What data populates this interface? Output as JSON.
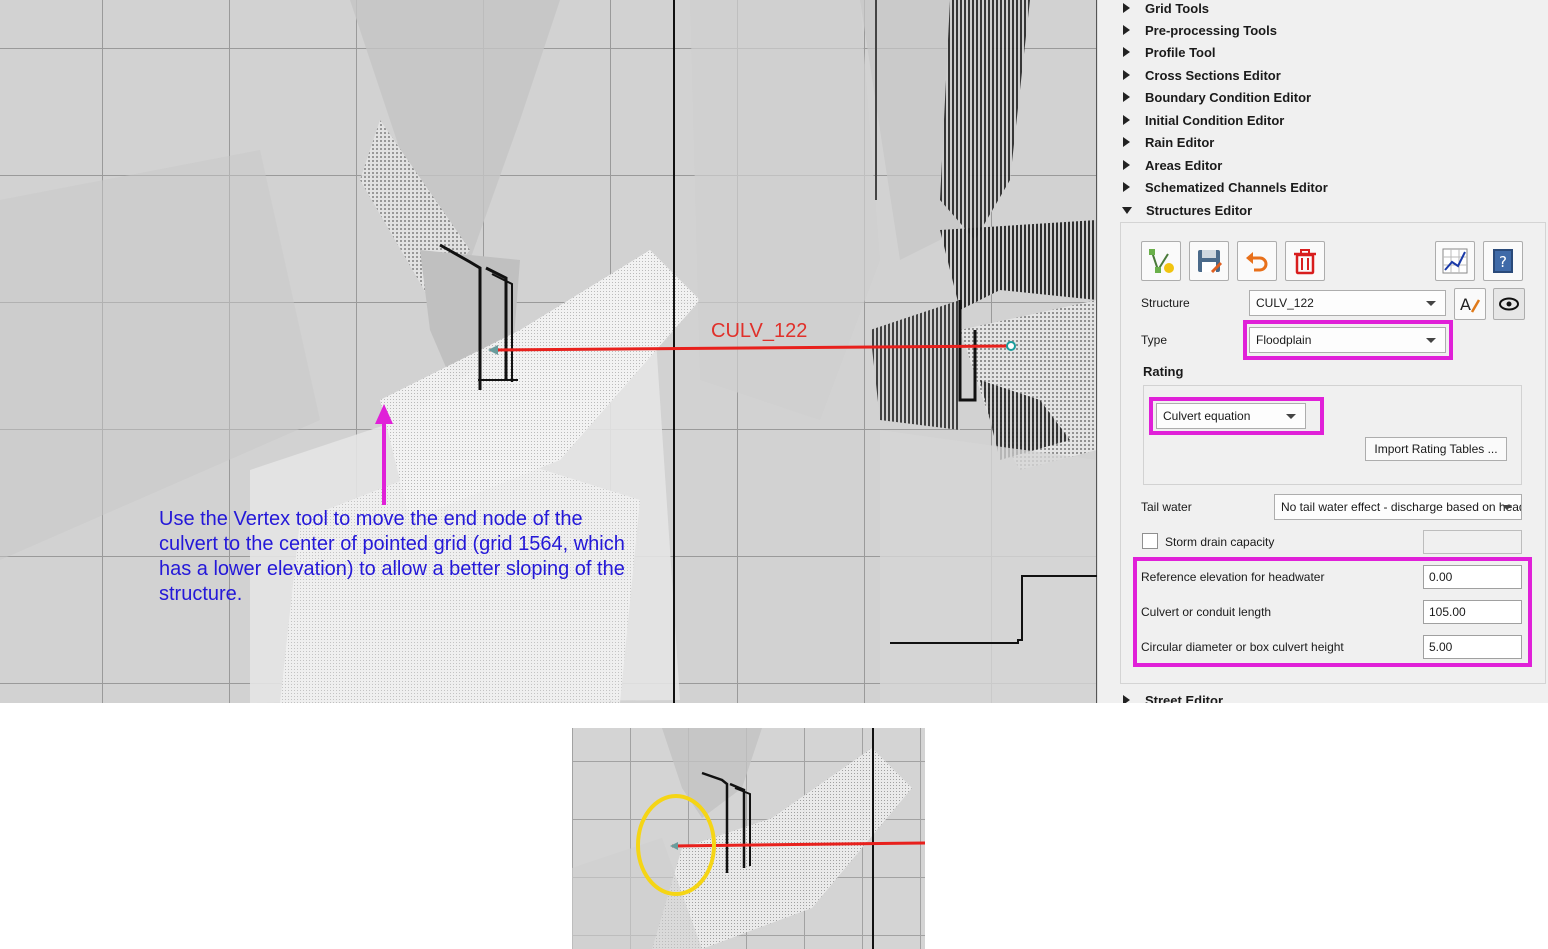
{
  "map": {
    "culvert_label": "CULV_122",
    "instruction": "Use the Vertex tool to move the end node of the culvert to the center of pointed grid (grid 1564, which has a lower elevation) to allow a better sloping of the structure."
  },
  "panel": {
    "tree_items": [
      {
        "label": "Grid Tools",
        "expanded": false
      },
      {
        "label": "Pre-processing Tools",
        "expanded": false
      },
      {
        "label": "Profile Tool",
        "expanded": false
      },
      {
        "label": "Cross Sections Editor",
        "expanded": false
      },
      {
        "label": "Boundary Condition Editor",
        "expanded": false
      },
      {
        "label": "Initial Condition Editor",
        "expanded": false
      },
      {
        "label": "Rain Editor",
        "expanded": false
      },
      {
        "label": "Areas Editor",
        "expanded": false
      },
      {
        "label": "Schematized Channels Editor",
        "expanded": false
      },
      {
        "label": "Structures Editor",
        "expanded": true
      }
    ],
    "bottom_item": "Street Editor",
    "toolbar_icons": [
      "add-structure-icon",
      "save-icon",
      "undo-icon",
      "delete-icon",
      "profile-icon",
      "help-icon"
    ],
    "structure": {
      "label": "Structure",
      "value": "CULV_122"
    },
    "type": {
      "label": "Type",
      "value": "Floodplain"
    },
    "rating": {
      "heading": "Rating",
      "value": "Culvert equation",
      "import_button": "Import Rating Tables ..."
    },
    "tail_water": {
      "label": "Tail water",
      "value": "No tail water effect - discharge based on headwater"
    },
    "storm_drain": {
      "label": "Storm drain capacity",
      "checked": false,
      "value": ""
    },
    "fields": {
      "ref_elev_label": "Reference elevation for headwater",
      "ref_elev_value": "0.00",
      "length_label": "Culvert or conduit length",
      "length_value": "105.00",
      "diameter_label": "Circular diameter or box culvert height",
      "diameter_value": "5.00"
    }
  },
  "colors": {
    "highlight": "#e020d8",
    "culvert_line": "#e8201c",
    "annotation_text": "#2418d8",
    "zoom_circle": "#f5d515"
  }
}
